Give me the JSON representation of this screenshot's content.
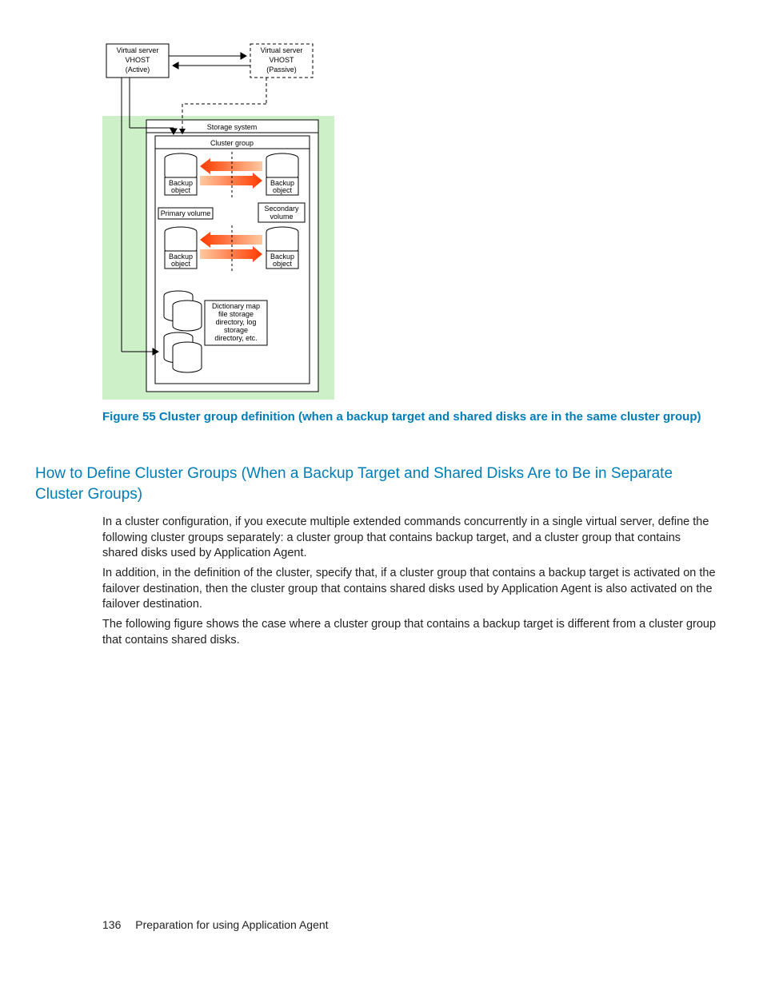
{
  "diagram": {
    "vserverActive": [
      "Virtual server",
      "VHOST",
      "(Active)"
    ],
    "vserverPassive": [
      "Virtual server",
      "VHOST",
      "(Passive)"
    ],
    "storageSystem": "Storage system",
    "clusterGroup": "Cluster group",
    "backupObject": "Backup\nobject",
    "primaryVolume": "Primary volume",
    "secondaryVolume": "Secondary\nvolume",
    "dictMap": "Dictionary map\nfile storage\ndirectory, log\nstorage\ndirectory, etc."
  },
  "figureCaption": "Figure 55 Cluster group definition (when a backup target and shared disks are in the same cluster group)",
  "sectionHeading": "How to Define Cluster Groups (When a Backup Target and Shared Disks Are to Be in Separate Cluster Groups)",
  "para1": "In a cluster configuration, if you execute multiple extended commands concurrently in a single virtual server, define the following cluster groups separately: a cluster group that contains backup target, and a cluster group that contains shared disks used by Application Agent.",
  "para2": "In addition, in the definition of the cluster, specify that, if a cluster group that contains a backup target is activated on the failover destination, then the cluster group that contains shared disks used by Application Agent is also activated on the failover destination.",
  "para3": "The following figure shows the case where a cluster group that contains a backup target is different from a cluster group that contains shared disks.",
  "pageNumber": "136",
  "footerText": "Preparation for using Application Agent"
}
